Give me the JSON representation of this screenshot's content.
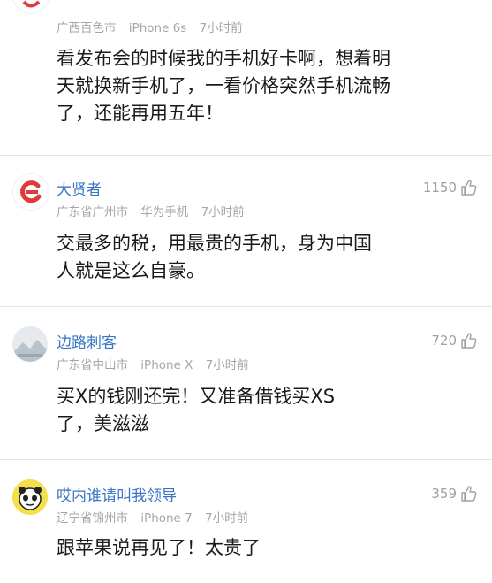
{
  "comments": [
    {
      "username": "",
      "location": "广西百色市",
      "device": "iPhone 6s",
      "time": "7小时前",
      "lines": [
        "看发布会的时候我的手机好卡啊，想着明",
        "天就换新手机了，一看价格突然手机流畅",
        "了，还能再用五年！"
      ],
      "likes": ""
    },
    {
      "username": "大贤者",
      "location": "广东省广州市",
      "device": "华为手机",
      "time": "7小时前",
      "lines": [
        "交最多的税，用最贵的手机，身为中国",
        "人就是这么自豪。"
      ],
      "likes": "1150"
    },
    {
      "username": "边路刺客",
      "location": "广东省中山市",
      "device": "iPhone X",
      "time": "7小时前",
      "lines": [
        "买X的钱刚还完！又准备借钱买XS",
        "了，美滋滋"
      ],
      "likes": "720"
    },
    {
      "username": "哎内谁请叫我领导",
      "location": "辽宁省锦州市",
      "device": "iPhone 7",
      "time": "7小时前",
      "lines": [
        "跟苹果说再见了！太贵了"
      ],
      "likes": "359"
    }
  ],
  "icons": {
    "like": "thumbs-up-icon"
  },
  "colors": {
    "username": "#3a76c4",
    "meta": "#a6a6a6",
    "divider": "#e6e6e6",
    "avatar_red": "#e03a3a"
  }
}
